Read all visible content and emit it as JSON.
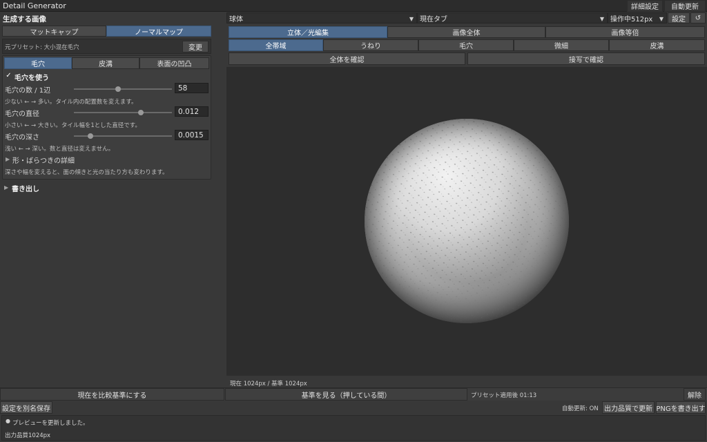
{
  "app": {
    "title": "Detail Generator",
    "btn_advanced": "詳細設定",
    "btn_auto_update": "自動更新"
  },
  "left": {
    "section_title": "生成する画像",
    "mode_tabs": [
      "マットキャップ",
      "ノーマルマップ"
    ],
    "preset_label": "元プリセット: 大小混在毛穴",
    "change_button": "変更",
    "detail_tabs": [
      "毛穴",
      "皮溝",
      "表面の凹凸"
    ],
    "use_pores_label": "毛穴を使う",
    "params": [
      {
        "label": "毛穴の数 / 1辺",
        "value": "58",
        "hint": "少ない ← → 多い。タイル内の配置数を変えます。",
        "level": 0.45
      },
      {
        "label": "毛穴の直径",
        "value": "0.012",
        "hint": "小さい ← → 大きい。タイル幅を1とした直径です。",
        "level": 0.68
      },
      {
        "label": "毛穴の深さ",
        "value": "0.0015",
        "hint": "浅い ← → 深い。数と直径は変えません。",
        "level": 0.17
      }
    ],
    "shape_details_label": "形・ばらつきの詳細",
    "shape_details_hint": "深さや幅を変えると、面の傾きと光の当たり方も変わります。",
    "export_label": "書き出し"
  },
  "right": {
    "shape_select": "球体",
    "tab_select": "現在タブ",
    "resolution_select": "操作中512px",
    "settings_button": "設定",
    "reset_icon": "refresh-icon",
    "view_tabs": [
      "立体／光編集",
      "画像全体",
      "画像等倍"
    ],
    "band_tabs": [
      "全帯域",
      "うねり",
      "毛穴",
      "微細",
      "皮溝"
    ],
    "confirm_all": "全体を確認",
    "confirm_closeup": "接写で確認",
    "resolution_info": "現在 1024px / 基準 1024px"
  },
  "bottom": {
    "set_baseline": "現在を比較基準にする",
    "view_baseline": "基準を見る（押している間）",
    "preset_applied": "プリセット適用後 01:13",
    "release": "解除",
    "save_as": "設定を別名保存",
    "auto_update_status": "自動更新: ON",
    "update_quality": "出力品質で更新",
    "export_png": "PNGを書き出す",
    "log_message": "プレビューを更新しました。",
    "output_quality": "出力品質1024px"
  },
  "colors": {
    "accent": "#4c6a8e",
    "panel": "#383838",
    "viewport": "#2d2d2d"
  }
}
